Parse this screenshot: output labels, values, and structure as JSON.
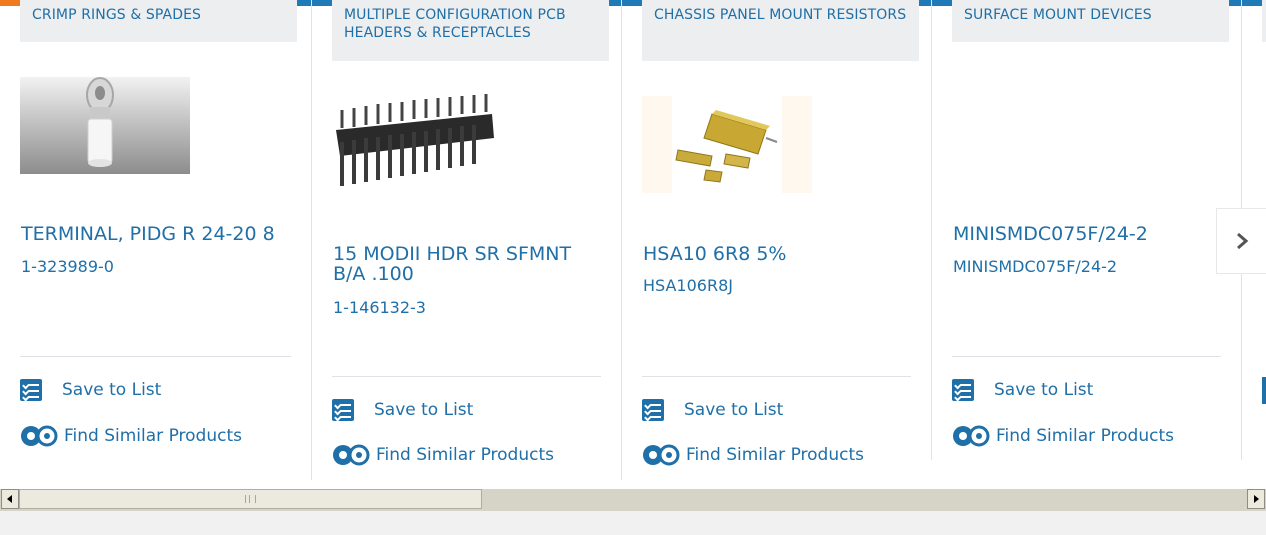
{
  "colors": {
    "accent": "#1f7ab8",
    "link": "#1f6fa8",
    "orange": "#f07b1e",
    "category_bg": "#eceeef"
  },
  "products": [
    {
      "category": "CRIMP RINGS & SPADES",
      "title": "TERMINAL, PIDG R 24-20 8",
      "part_number": "1-323989-0",
      "save_label": "Save to List",
      "similar_label": "Find Similar Products",
      "image": "ring-terminal-photo"
    },
    {
      "category": "MULTIPLE CONFIGURATION PCB HEADERS & RECEPTACLES",
      "title": "15 MODII HDR SR SFMNT B/A .100",
      "part_number": "1-146132-3",
      "save_label": "Save to List",
      "similar_label": "Find Similar Products",
      "image": "pin-header-photo"
    },
    {
      "category": "CHASSIS PANEL MOUNT RESISTORS",
      "title": "HSA10 6R8 5%",
      "part_number": "HSA106R8J",
      "save_label": "Save to List",
      "similar_label": "Find Similar Products",
      "image": "resistor-photo"
    },
    {
      "category": "SURFACE MOUNT DEVICES",
      "title": "MINISMDC075F/24-2",
      "part_number": "MINISMDC075F/24-2",
      "save_label": "Save to List",
      "similar_label": "Find Similar Products",
      "image": ""
    }
  ],
  "icons": {
    "next": "chevron-right-icon",
    "save": "checklist-icon",
    "similar": "gears-icon"
  }
}
